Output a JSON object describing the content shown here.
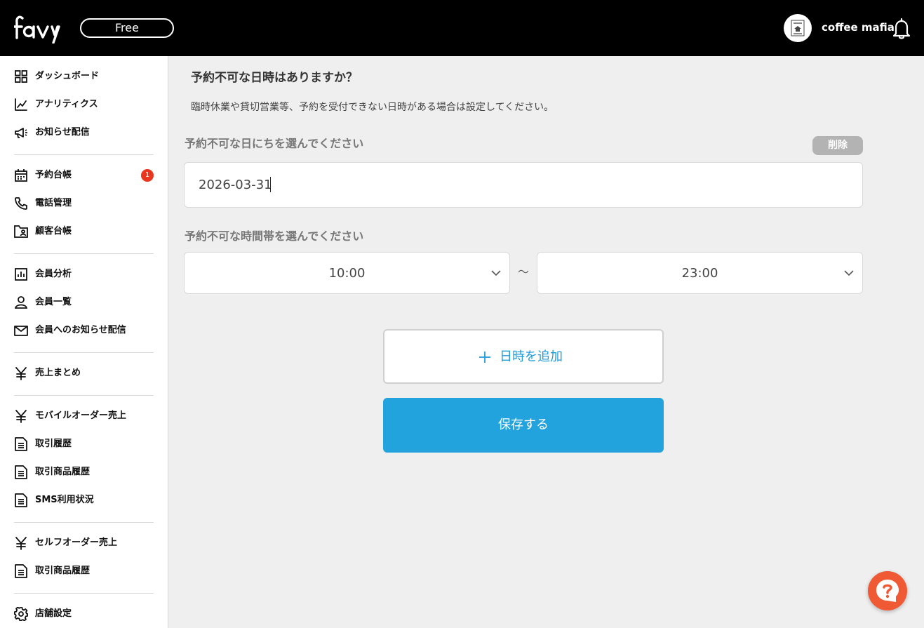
{
  "header": {
    "logo_text": "favy",
    "plan": "Free",
    "shop_name": "coffee mafia",
    "avatar_text": "COFFEE MAFIA"
  },
  "sidebar": {
    "items": [
      {
        "label": "ダッシュボード",
        "icon": "dashboard-icon"
      },
      {
        "label": "アナリティクス",
        "icon": "analytics-icon"
      },
      {
        "label": "お知らせ配信",
        "icon": "megaphone-icon"
      },
      {
        "label": "予約台帳",
        "icon": "calendar-icon",
        "badge": "1"
      },
      {
        "label": "電話管理",
        "icon": "phone-icon"
      },
      {
        "label": "顧客台帳",
        "icon": "contact-book-icon"
      },
      {
        "label": "会員分析",
        "icon": "bar-chart-icon"
      },
      {
        "label": "会員一覧",
        "icon": "person-icon"
      },
      {
        "label": "会員へのお知らせ配信",
        "icon": "mail-icon"
      },
      {
        "label": "売上まとめ",
        "icon": "yen-icon"
      },
      {
        "label": "モバイルオーダー売上",
        "icon": "yen-icon"
      },
      {
        "label": "取引履歴",
        "icon": "document-icon"
      },
      {
        "label": "取引商品履歴",
        "icon": "document-icon"
      },
      {
        "label": "SMS利用状況",
        "icon": "document-icon"
      },
      {
        "label": "セルフオーダー売上",
        "icon": "yen-icon"
      },
      {
        "label": "取引商品履歴",
        "icon": "document-icon"
      },
      {
        "label": "店舗設定",
        "icon": "gear-icon"
      }
    ]
  },
  "main": {
    "question": "予約不可な日時はありますか？",
    "description": "臨時休業や貸切営業等、予約を受付できない日時がある場合は設定してください。",
    "date_label": "予約不可な日にちを選んでください",
    "delete_label": "削除",
    "date_value": "2026-03-31",
    "time_label": "予約不可な時間帯を選んでください",
    "time_start": "10:00",
    "time_separator": "〜",
    "time_end": "23:00",
    "add_label": "日時を追加",
    "save_label": "保存する"
  },
  "colors": {
    "accent": "#22a3de",
    "add_text": "#1f9bd9",
    "badge": "#e8361f",
    "help": "#ef5a35",
    "header_bg": "#000000"
  }
}
